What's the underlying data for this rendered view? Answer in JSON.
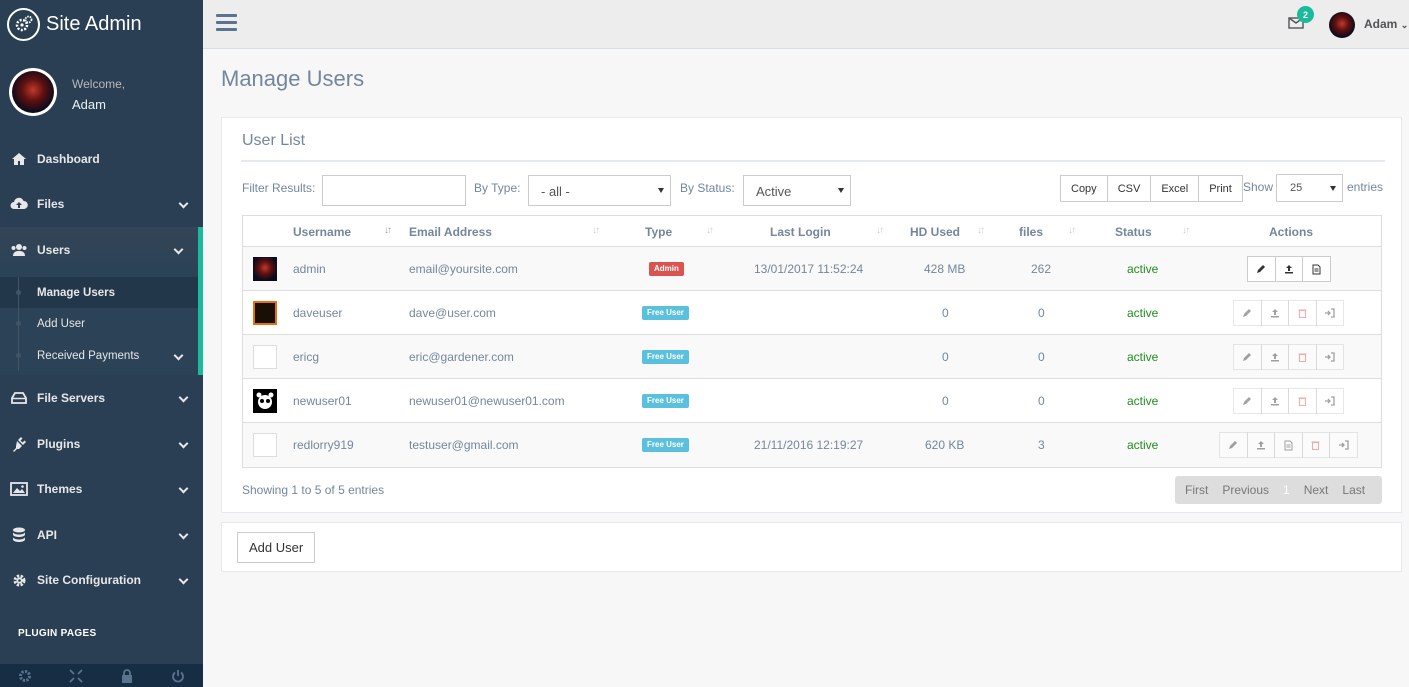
{
  "brand": {
    "title": "Site Admin"
  },
  "profile": {
    "welcome": "Welcome,",
    "name": "Adam"
  },
  "sidebar": {
    "items": [
      {
        "label": "Dashboard",
        "icon": "home-icon"
      },
      {
        "label": "Files",
        "icon": "cloud-upload-icon"
      },
      {
        "label": "Users",
        "icon": "users-icon"
      },
      {
        "label": "File Servers",
        "icon": "hdd-icon"
      },
      {
        "label": "Plugins",
        "icon": "plug-icon"
      },
      {
        "label": "Themes",
        "icon": "picture-icon"
      },
      {
        "label": "API",
        "icon": "database-icon"
      },
      {
        "label": "Site Configuration",
        "icon": "gear-icon"
      }
    ],
    "users_sub": [
      "Manage Users",
      "Add User",
      "Received Payments"
    ],
    "plugin_pages": "PLUGIN PAGES"
  },
  "topbar": {
    "mail_count": "2",
    "user": "Adam"
  },
  "page": {
    "title": "Manage Users"
  },
  "panel": {
    "title": "User List",
    "filter_label": "Filter Results:",
    "type_label": "By Type:",
    "type_value": "- all -",
    "status_label": "By Status:",
    "status_value": "Active",
    "buttons": [
      "Copy",
      "CSV",
      "Excel",
      "Print"
    ],
    "show_label": "Show",
    "show_value": "25",
    "entries_label": "entries"
  },
  "table": {
    "headers": [
      "Username",
      "Email Address",
      "Type",
      "Last Login",
      "HD Used",
      "files",
      "Status",
      "Actions"
    ],
    "rows": [
      {
        "username": "admin",
        "email": "email@yoursite.com",
        "type": "Admin",
        "last_login": "13/01/2017 11:52:24",
        "hd": "428 MB",
        "files": "262",
        "status": "active"
      },
      {
        "username": "daveuser",
        "email": "dave@user.com",
        "type": "Free User",
        "last_login": "",
        "hd": "0",
        "files": "0",
        "status": "active"
      },
      {
        "username": "ericg",
        "email": "eric@gardener.com",
        "type": "Free User",
        "last_login": "",
        "hd": "0",
        "files": "0",
        "status": "active"
      },
      {
        "username": "newuser01",
        "email": "newuser01@newuser01.com",
        "type": "Free User",
        "last_login": "",
        "hd": "0",
        "files": "0",
        "status": "active"
      },
      {
        "username": "redlorry919",
        "email": "testuser@gmail.com",
        "type": "Free User",
        "last_login": "21/11/2016 12:19:27",
        "hd": "620 KB",
        "files": "3",
        "status": "active"
      }
    ]
  },
  "footer": {
    "showing": "Showing 1 to 5 of 5 entries",
    "pager": [
      "First",
      "Previous",
      "1",
      "Next",
      "Last"
    ]
  },
  "add_user": "Add User"
}
